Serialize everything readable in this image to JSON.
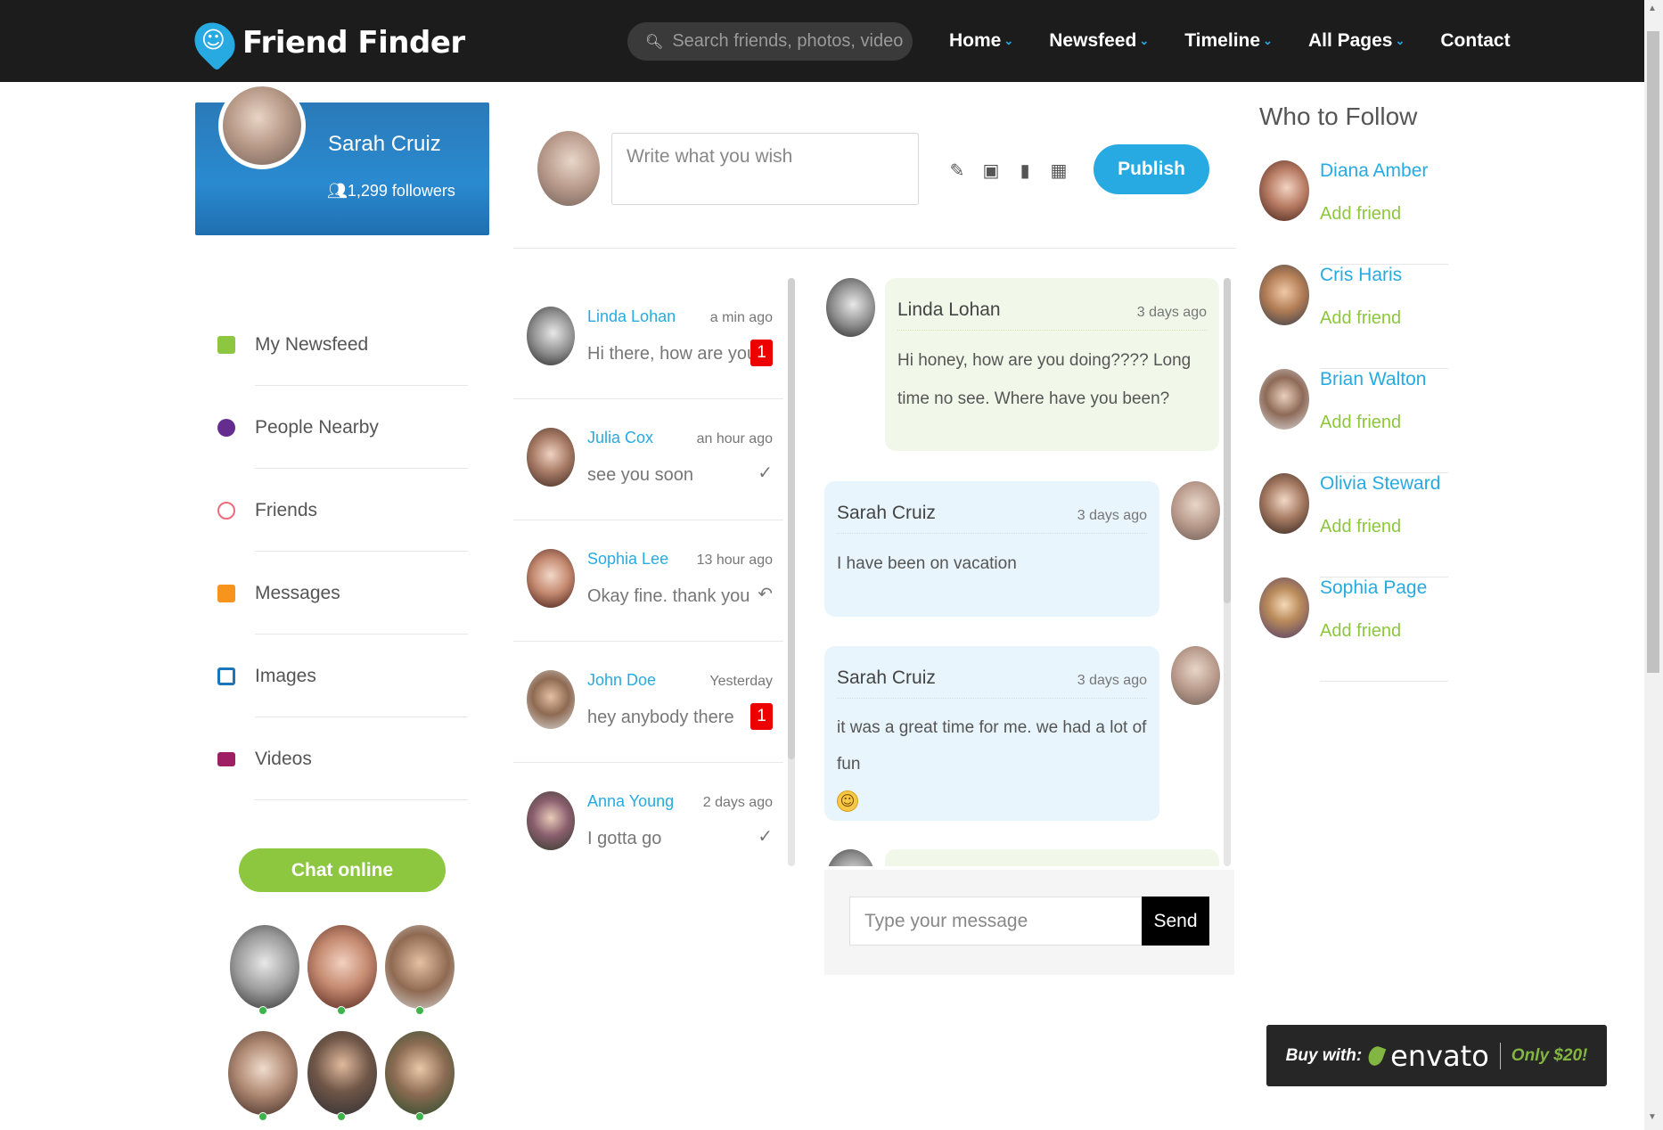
{
  "brand": {
    "name": "Friend Finder",
    "accent": "#27aae1",
    "green": "#8dc63f"
  },
  "search": {
    "placeholder": "Search friends, photos, videos"
  },
  "nav": {
    "items": [
      {
        "label": "Home"
      },
      {
        "label": "Newsfeed"
      },
      {
        "label": "Timeline"
      },
      {
        "label": "All Pages"
      },
      {
        "label": "Contact"
      }
    ]
  },
  "profile": {
    "name": "Sarah Cruiz",
    "followers": "1,299 followers"
  },
  "menu": {
    "items": [
      {
        "label": "My Newsfeed",
        "icon": "newsfeed-icon",
        "color": "#8dc63f"
      },
      {
        "label": "People Nearby",
        "icon": "people-nearby-icon",
        "color": "#662d91"
      },
      {
        "label": "Friends",
        "icon": "friends-icon",
        "color": "#ee6a7b"
      },
      {
        "label": "Messages",
        "icon": "messages-icon",
        "color": "#f7941d"
      },
      {
        "label": "Images",
        "icon": "images-icon",
        "color": "#1b75bb"
      },
      {
        "label": "Videos",
        "icon": "videos-icon",
        "color": "#9e1f63"
      }
    ],
    "chat_online": "Chat online"
  },
  "post": {
    "placeholder": "Write what you wish",
    "publish": "Publish"
  },
  "conversations": [
    {
      "name": "Linda Lohan",
      "time": "a min ago",
      "text": "Hi there, how are you",
      "badge": "1",
      "status": ""
    },
    {
      "name": "Julia Cox",
      "time": "an hour ago",
      "text": "see you soon",
      "badge": "",
      "status": "✓"
    },
    {
      "name": "Sophia Lee",
      "time": "13 hour ago",
      "text": "Okay fine. thank you",
      "badge": "",
      "status": "↶"
    },
    {
      "name": "John Doe",
      "time": "Yesterday",
      "text": "hey anybody there",
      "badge": "1",
      "status": ""
    },
    {
      "name": "Anna Young",
      "time": "2 days ago",
      "text": "I gotta go",
      "badge": "",
      "status": "✓"
    }
  ],
  "messages": [
    {
      "author": "Linda Lohan",
      "time": "3 days ago",
      "text": "Hi honey, how are you doing???? Long time no see. Where have you been?"
    },
    {
      "author": "Sarah Cruiz",
      "time": "3 days ago",
      "text": "I have been on vacation"
    },
    {
      "author": "Sarah Cruiz",
      "time": "3 days ago",
      "text": "it was a great time for me. we had a lot of fun",
      "emoji": "☺"
    }
  ],
  "composer": {
    "placeholder": "Type your message",
    "send": "Send"
  },
  "who_to_follow": {
    "title": "Who to Follow",
    "people": [
      {
        "name": "Diana Amber",
        "action": "Add friend"
      },
      {
        "name": "Cris Haris",
        "action": "Add friend"
      },
      {
        "name": "Brian Walton",
        "action": "Add friend"
      },
      {
        "name": "Olivia Steward",
        "action": "Add friend"
      },
      {
        "name": "Sophia Page",
        "action": "Add friend"
      }
    ]
  },
  "envato": {
    "buy": "Buy with:",
    "brand": "envato",
    "price": "Only $20!"
  }
}
